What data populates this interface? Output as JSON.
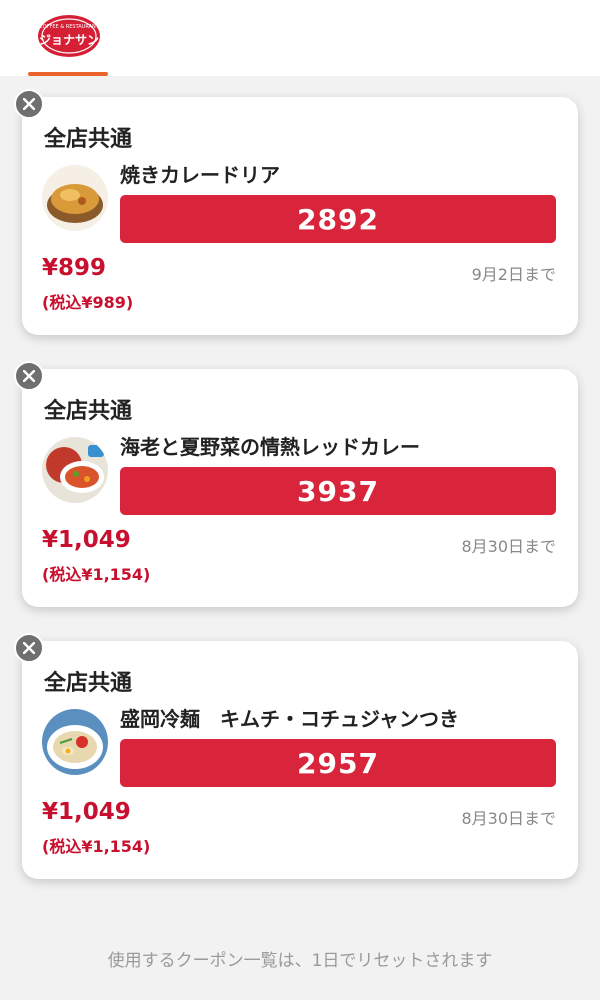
{
  "header": {
    "logo_text_top": "COFFEE & RESTAURANT",
    "logo_text_main": "ジョナサン"
  },
  "coupons": [
    {
      "scope": "全店共通",
      "item": "焼きカレードリア",
      "code": "2892",
      "price": "¥899",
      "price_tax": "(税込¥989)",
      "expiry": "9月2日まで"
    },
    {
      "scope": "全店共通",
      "item": "海老と夏野菜の情熱レッドカレー",
      "code": "3937",
      "price": "¥1,049",
      "price_tax": "(税込¥1,154)",
      "expiry": "8月30日まで"
    },
    {
      "scope": "全店共通",
      "item": "盛岡冷麺　キムチ・コチュジャンつき",
      "code": "2957",
      "price": "¥1,049",
      "price_tax": "(税込¥1,154)",
      "expiry": "8月30日まで"
    }
  ],
  "footer": {
    "note": "使用するクーポン一覧は、1日でリセットされます"
  },
  "colors": {
    "brand_red": "#d9253b",
    "tab_accent": "#e8642a",
    "price_red": "#c8102e"
  }
}
